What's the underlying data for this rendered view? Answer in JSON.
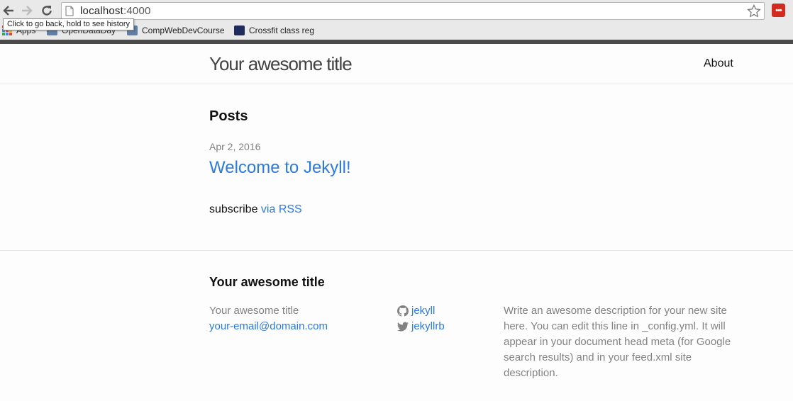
{
  "browser": {
    "url_host": "localhost",
    "url_port": ":4000",
    "tooltip": "Click to go back, hold to see history",
    "bookmarks": [
      {
        "label": "Apps"
      },
      {
        "label": "OpenDataDay"
      },
      {
        "label": "CompWebDevCourse"
      },
      {
        "label": "Crossfit class reg"
      }
    ],
    "extension_label": "•••"
  },
  "header": {
    "site_title": "Your awesome title",
    "nav": [
      {
        "label": "About"
      }
    ]
  },
  "main": {
    "posts_heading": "Posts",
    "posts": [
      {
        "date": "Apr 2, 2016",
        "title": "Welcome to Jekyll!"
      }
    ],
    "rss_prefix": "subscribe ",
    "rss_link": "via RSS"
  },
  "footer": {
    "heading": "Your awesome title",
    "name": "Your awesome title",
    "email": "your-email@domain.com",
    "github": "jekyll",
    "twitter": "jekyllrb",
    "description": "Write an awesome description for your new site here. You can edit this line in _config.yml. It will appear in your document head meta (for Google search results) and in your feed.xml site description."
  },
  "colors": {
    "link": "#2a7ae2",
    "text": "#111111",
    "muted": "#828282",
    "extension": "#d32a1f"
  }
}
